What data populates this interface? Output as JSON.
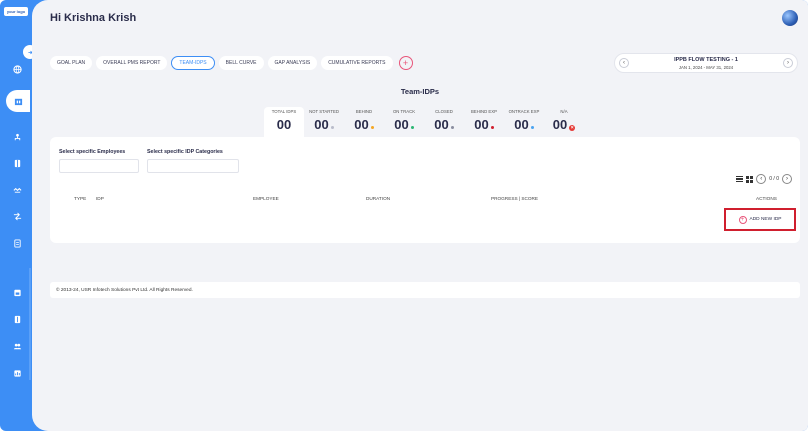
{
  "brand": {
    "logo_text": "your logo"
  },
  "header": {
    "greeting": "Hi Krishna Krish"
  },
  "tabs": [
    {
      "label": "GOAL PLAN",
      "active": false
    },
    {
      "label": "OVERALL PMS REPORT",
      "active": false
    },
    {
      "label": "TEAM-IDPS",
      "active": true
    },
    {
      "label": "BELL CURVE",
      "active": false
    },
    {
      "label": "GAP ANALYSIS",
      "active": false
    },
    {
      "label": "CUMULATIVE REPORTS",
      "active": false
    }
  ],
  "tab_add_label": "+",
  "cycle": {
    "title": "IPPB FLOW TESTING - 1",
    "dates": "JAN 1, 2024 - MAY 31, 2024",
    "prev": "‹",
    "next": "›"
  },
  "section_title": "Team-IDPs",
  "stats": [
    {
      "label": "TOTAL IDPS",
      "value": "00",
      "color": ""
    },
    {
      "label": "NOT STARTED",
      "value": "00",
      "color": "#b9bccb"
    },
    {
      "label": "BEHIND",
      "value": "00",
      "color": "#f5a623"
    },
    {
      "label": "ON TRACK",
      "value": "00",
      "color": "#2bb673"
    },
    {
      "label": "CLOSED",
      "value": "00",
      "color": "#8a8da0"
    },
    {
      "label": "BEHIND EXP",
      "value": "00",
      "color": "#d01f2e"
    },
    {
      "label": "ONTRACK EXP",
      "value": "00",
      "color": "#4aa3f0"
    },
    {
      "label": "N/A",
      "value": "00",
      "color": "#e53935"
    }
  ],
  "filters": {
    "employees_label": "Select specific Employees",
    "categories_label": "Select specific IDP Categories"
  },
  "pagination": {
    "text": "0 / 0"
  },
  "table": {
    "columns": [
      "TYPE",
      "IDP",
      "EMPLOYEE",
      "DURATION",
      "PROGRESS | SCORE",
      "ACTIONS"
    ]
  },
  "add_idp_label": "ADD NEW IDP",
  "footer": {
    "text": "© 2013-24, USR Infotech Solutions Pvt Ltd. All Rights Reserved."
  }
}
